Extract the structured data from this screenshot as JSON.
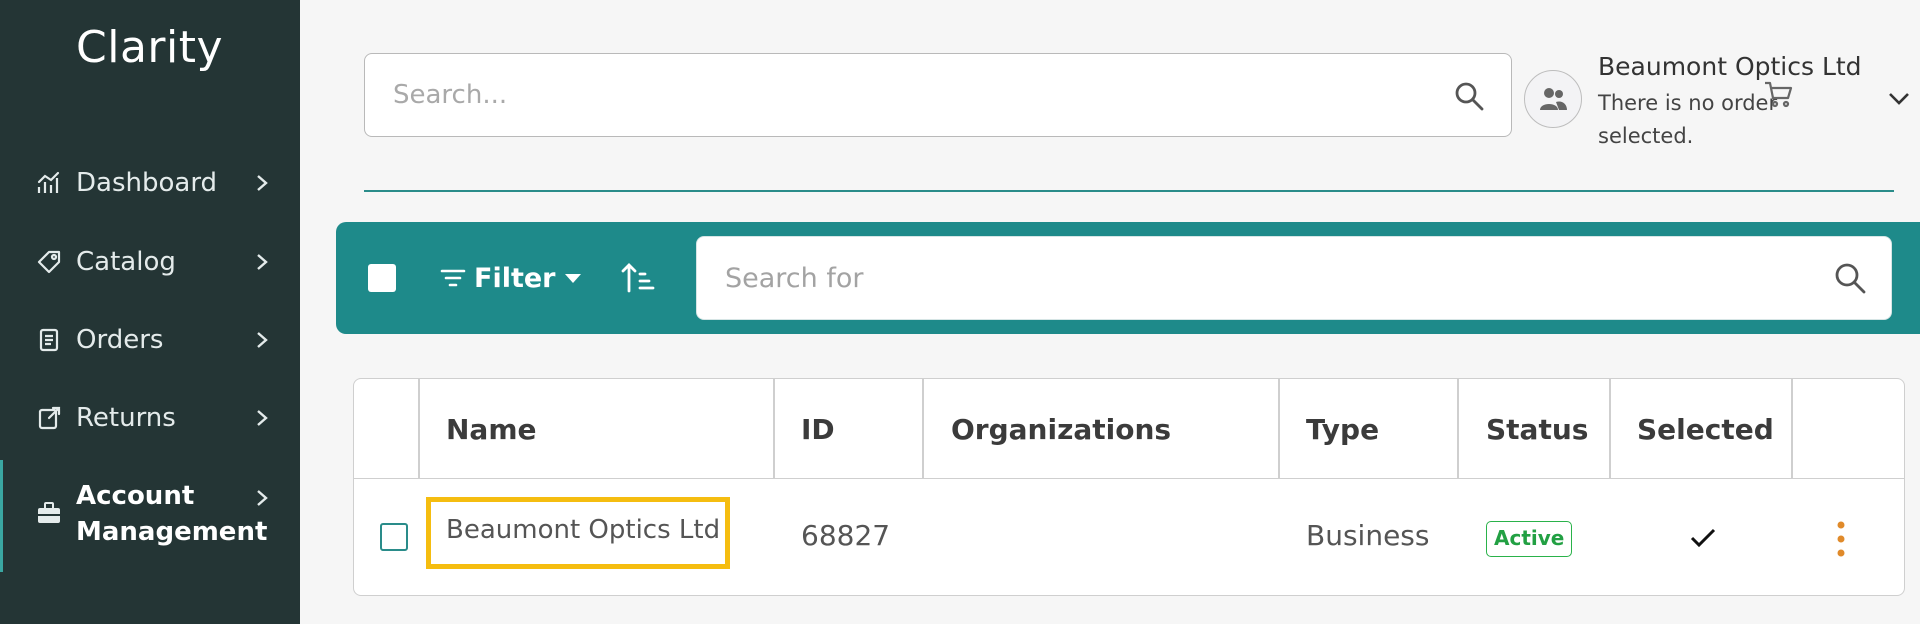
{
  "sidebar": {
    "logo": "Clarity",
    "items": [
      {
        "label": "Dashboard",
        "icon": "chart-icon"
      },
      {
        "label": "Catalog",
        "icon": "tag-icon"
      },
      {
        "label": "Orders",
        "icon": "document-icon"
      },
      {
        "label": "Returns",
        "icon": "return-icon"
      },
      {
        "label": "Account Management",
        "icon": "briefcase-icon",
        "active": true
      }
    ]
  },
  "header": {
    "search_placeholder": "Search...",
    "account_name": "Beaumont Optics Ltd",
    "order_status": "There is no order selected."
  },
  "toolbar": {
    "filter_label": "Filter",
    "search_placeholder": "Search for"
  },
  "table": {
    "columns": [
      "Name",
      "ID",
      "Organizations",
      "Type",
      "Status",
      "Selected"
    ],
    "rows": [
      {
        "name": "Beaumont Optics Ltd",
        "id": "68827",
        "organizations": "",
        "type": "Business",
        "status": "Active",
        "selected": true
      }
    ]
  },
  "colors": {
    "sidebar_bg": "#243535",
    "accent": "#1e8a8a",
    "status_active": "#22a043",
    "highlight": "#f5bd10",
    "kebab": "#e08a2a"
  }
}
